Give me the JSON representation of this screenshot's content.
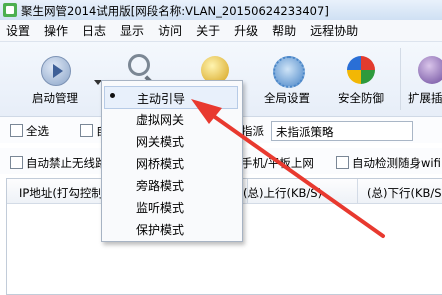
{
  "window": {
    "title": "聚生网管2014试用版[网段名称:VLAN_20150624233407]"
  },
  "menubar": {
    "items": [
      "设置",
      "操作",
      "日志",
      "显示",
      "访问",
      "关于",
      "升级",
      "帮助",
      "远程协助"
    ]
  },
  "toolbar": {
    "start_label": "启动管理",
    "global_settings_label": "全局设置",
    "security_label": "安全防御",
    "extension_label": "扩展插"
  },
  "options": {
    "select_all_label": "全选",
    "hidden_label_fragment": "自",
    "assign_label_fragment": "指派",
    "policy_value": "未指派策略",
    "auto_block_wireless_label": "自动禁止无线路",
    "phone_pad_label": "手机/平板上网",
    "auto_detect_wifi_label": "自动检测随身wifi"
  },
  "table": {
    "columns": [
      "IP地址(打勾控制",
      "(总)上行(KB/S)",
      "(总)下行(KB/S"
    ]
  },
  "dropdown": {
    "items": [
      {
        "label": "主动引导",
        "selected": true
      },
      {
        "label": "虚拟网关",
        "selected": false
      },
      {
        "label": "网关模式",
        "selected": false
      },
      {
        "label": "网桥模式",
        "selected": false
      },
      {
        "label": "旁路模式",
        "selected": false
      },
      {
        "label": "监听模式",
        "selected": false
      },
      {
        "label": "保护模式",
        "selected": false
      }
    ]
  },
  "annotation": {
    "arrow_color": "#e8392f"
  }
}
